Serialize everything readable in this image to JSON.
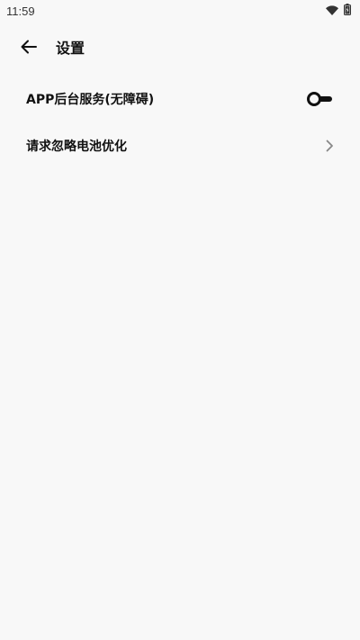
{
  "status_bar": {
    "time": "11:59",
    "icons": [
      "wifi-icon",
      "battery-charging-icon"
    ]
  },
  "app_bar": {
    "back_icon": "arrow-left-icon",
    "title": "设置"
  },
  "settings": [
    {
      "label": "APP后台服务(无障碍)",
      "control": "toggle",
      "state": "off"
    },
    {
      "label": "请求忽略电池优化",
      "control": "chevron",
      "icon": "chevron-right-icon"
    }
  ],
  "colors": {
    "background": "#f8f8f8",
    "text": "#111111",
    "chevron": "#888888"
  }
}
